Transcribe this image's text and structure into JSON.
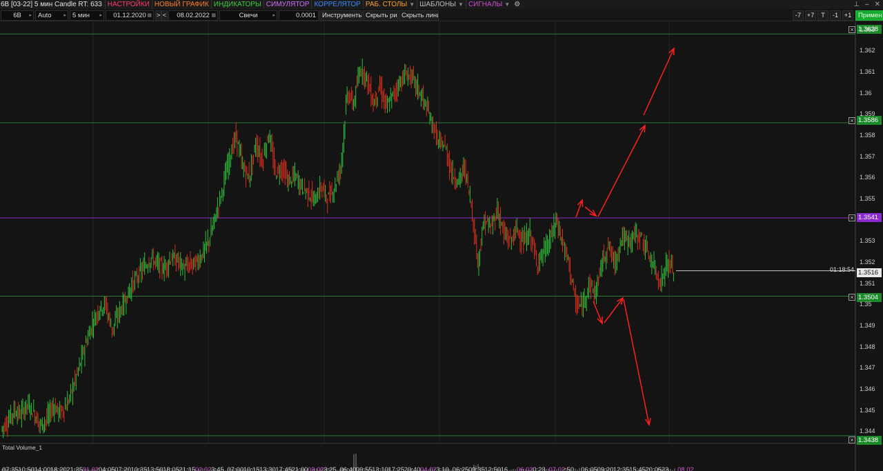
{
  "menubar": {
    "title": "6B [03-22] 5 мин Candle RT: 633",
    "menus": [
      {
        "label": "НАСТРОЙКИ",
        "color": "#ff3b6b"
      },
      {
        "label": "НОВЫЙ ГРАФИК",
        "color": "#ff7f2a"
      },
      {
        "label": "ИНДИКАТОРЫ",
        "color": "#3bcf3b"
      },
      {
        "label": "СИМУЛЯТОР",
        "color": "#d36cff"
      },
      {
        "label": "КОРРЕЛЯТОР",
        "color": "#3b8bff"
      },
      {
        "label": "РАБ. СТОЛЫ",
        "color": "#ff9f2a"
      },
      {
        "label": "ШАБЛОНЫ",
        "color": "#bdbdbd"
      },
      {
        "label": "СИГНАЛЫ",
        "color": "#d34bd3"
      }
    ],
    "gear_icon": "gear-icon",
    "pin_icon": "pin-icon",
    "minimize_icon": "minimize-icon",
    "close_icon": "close-icon"
  },
  "toolbar": {
    "symbol": "6B",
    "scale": "Auto",
    "timeframe": "5 мин",
    "date_from": "01.12.2020",
    "nav_next": ">",
    "nav_prev": "<",
    "date_to": "08.02.2022",
    "chart_type": "Свечи",
    "tick_size": "0.0001",
    "instruments": "Инструменты",
    "hide_drawings": "Скрыть рис.",
    "hide_lines": "Скрыть линии",
    "zoom_minus7": "-7",
    "zoom_plus7": "+7",
    "t_button": "T",
    "zoom_minus1": "-1",
    "zoom_plus1": "+1",
    "apply": "Применить"
  },
  "levels": [
    {
      "label": "1.3628",
      "price": 1.3628,
      "color": "#2aa845",
      "line": "#2f7a3a"
    },
    {
      "label": "1.3586",
      "price": 1.3586,
      "color": "#2aa845",
      "line": "#2f7a3a"
    },
    {
      "label": "1.3541",
      "price": 1.3541,
      "color": "#8a2ad0",
      "line": "#8a2ad0"
    },
    {
      "label": "1.3504",
      "price": 1.3504,
      "color": "#2aa845",
      "line": "#2f7a3a"
    },
    {
      "label": "1.3438",
      "price": 1.3438,
      "color": "#2aa845",
      "line": "#2f7a3a"
    }
  ],
  "current_price": {
    "label": "1.3516",
    "price": 1.3516,
    "timer": "01:18:54"
  },
  "y_axis": {
    "labels": [
      "1.363",
      "1.362",
      "1.361",
      "1.36",
      "1.359",
      "1.358",
      "1.357",
      "1.356",
      "1.355",
      "1.353",
      "1.352",
      "1.351",
      "1.35",
      "1.349",
      "1.348",
      "1.347",
      "1.346",
      "1.345",
      "1.344"
    ],
    "min": 1.3436,
    "max": 1.3631
  },
  "x_axis": {
    "labels": [
      {
        "text": "07:35",
        "date": false
      },
      {
        "text": "10:50",
        "date": false
      },
      {
        "text": "14:00",
        "date": false
      },
      {
        "text": "18:20",
        "date": false
      },
      {
        "text": "21:35",
        "date": false
      },
      {
        "text": "01.02",
        "date": true
      },
      {
        "text": "04:05",
        "date": false
      },
      {
        "text": "07:20",
        "date": false
      },
      {
        "text": "10:35",
        "date": false
      },
      {
        "text": "13:50",
        "date": false
      },
      {
        "text": "18:05",
        "date": false
      },
      {
        "text": "21:15",
        "date": false
      },
      {
        "text": "02.02",
        "date": true
      },
      {
        "text": "3:45",
        "date": false
      },
      {
        "text": "07:00",
        "date": false
      },
      {
        "text": "10:15",
        "date": false
      },
      {
        "text": "13:30",
        "date": false
      },
      {
        "text": "17:45",
        "date": false
      },
      {
        "text": "21:00",
        "date": false
      },
      {
        "text": "03.02",
        "date": true
      },
      {
        "text": "3:25",
        "date": false
      },
      {
        "text": "06:40",
        "date": false
      },
      {
        "text": "09:55",
        "date": false
      },
      {
        "text": "13:10",
        "date": false
      },
      {
        "text": "17:25",
        "date": false
      },
      {
        "text": "20:40",
        "date": false
      },
      {
        "text": "04.02",
        "date": true
      },
      {
        "text": "3:10",
        "date": false
      },
      {
        "text": "06:25",
        "date": false
      },
      {
        "text": "09:35",
        "date": false
      },
      {
        "text": "12:50",
        "date": false
      },
      {
        "text": "16",
        "date": false
      },
      {
        "text": "06.02",
        "date": true
      },
      {
        "text": "0:23",
        "date": false
      },
      {
        "text": "07.02",
        "date": true
      },
      {
        "text": ":50",
        "date": false
      },
      {
        "text": "06:05",
        "date": false
      },
      {
        "text": "09:20",
        "date": false
      },
      {
        "text": "12:35",
        "date": false
      },
      {
        "text": "15:45",
        "date": false
      },
      {
        "text": "20:05",
        "date": false
      },
      {
        "text": "23",
        "date": false
      },
      {
        "text": "08.02",
        "date": true
      }
    ]
  },
  "volume_label": "Total Volume_1",
  "chart_data": {
    "type": "candlestick",
    "series": [
      {
        "name": "6B [03-22] 5 мин",
        "values": [
          1.3441,
          1.3445,
          1.345,
          1.3448,
          1.3453,
          1.3449,
          1.3443,
          1.3446,
          1.3452,
          1.3449,
          1.3452,
          1.3461,
          1.3471,
          1.3482,
          1.3491,
          1.3498,
          1.35,
          1.3488,
          1.3496,
          1.3502,
          1.3509,
          1.3514,
          1.3518,
          1.3522,
          1.3519,
          1.3517,
          1.3522,
          1.3521,
          1.3517,
          1.3519,
          1.352,
          1.3525,
          1.3532,
          1.3544,
          1.3556,
          1.357,
          1.358,
          1.3565,
          1.356,
          1.3576,
          1.3568,
          1.3581,
          1.3562,
          1.3565,
          1.3558,
          1.3561,
          1.3556,
          1.3553,
          1.3549,
          1.3556,
          1.355,
          1.3555,
          1.3565,
          1.36,
          1.3595,
          1.3612,
          1.3607,
          1.3595,
          1.3603,
          1.3593,
          1.3599,
          1.3605,
          1.3609,
          1.3607,
          1.3601,
          1.3594,
          1.3586,
          1.3576,
          1.3575,
          1.3562,
          1.3558,
          1.3565,
          1.3547,
          1.352,
          1.354,
          1.3536,
          1.3545,
          1.3533,
          1.353,
          1.3536,
          1.3529,
          1.3534,
          1.352,
          1.3524,
          1.353,
          1.354,
          1.3529,
          1.3519,
          1.35,
          1.3499,
          1.351,
          1.3505,
          1.352,
          1.3528,
          1.3519,
          1.3532,
          1.353,
          1.3533,
          1.3532,
          1.3524,
          1.3518,
          1.351,
          1.352,
          1.3516
        ]
      }
    ],
    "ylim": [
      1.3436,
      1.3631
    ],
    "grid": true
  }
}
